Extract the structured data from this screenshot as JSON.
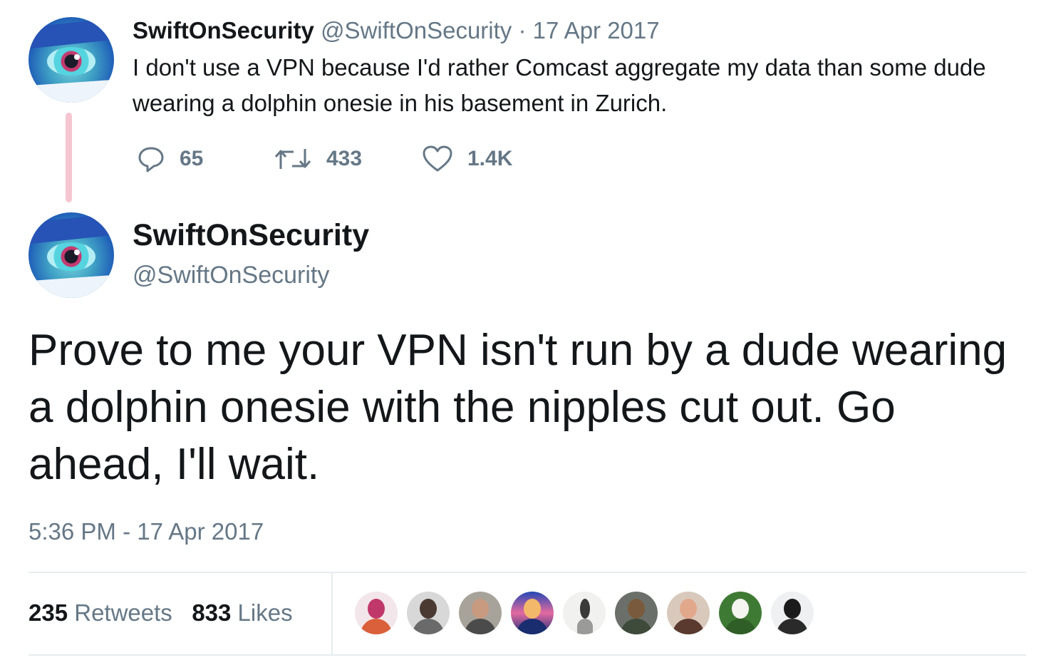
{
  "tweet1": {
    "name": "SwiftOnSecurity",
    "handle_date": "@SwiftOnSecurity · 17 Apr 2017",
    "text": "I don't use a VPN because I'd rather Comcast aggregate my data than some dude wearing a dolphin onesie in his basement in Zurich.",
    "replies": "65",
    "retweets": "433",
    "likes": "1.4K",
    "icons": {
      "reply": "reply-icon",
      "retweet": "retweet-icon",
      "like": "heart-icon"
    }
  },
  "tweet2": {
    "name": "SwiftOnSecurity",
    "handle": "@SwiftOnSecurity",
    "text": "Prove to me your VPN isn't run by a dude wearing a dolphin onesie with the nipples cut out. Go ahead, I'll wait.",
    "timestamp": "5:36 PM - 17 Apr 2017",
    "retweet_count": "235",
    "retweet_label": "Retweets",
    "like_count": "833",
    "like_label": "Likes"
  },
  "colors": {
    "text": "#14171a",
    "muted": "#657786",
    "thread_line": "#f6c6d0",
    "divider": "#e6ecf0"
  }
}
